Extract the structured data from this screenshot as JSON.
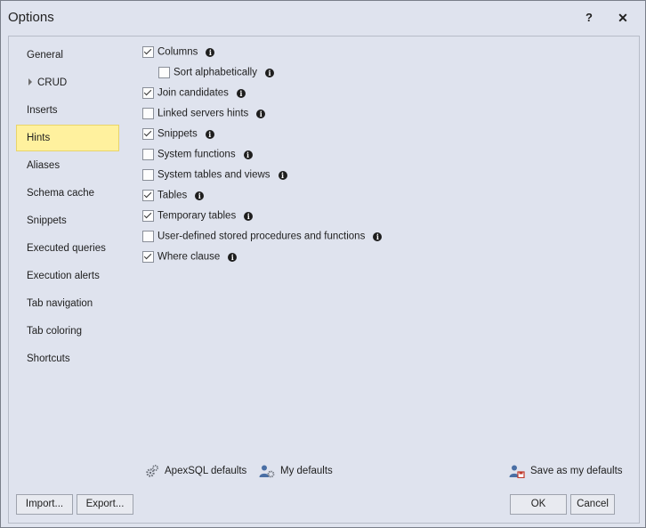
{
  "window": {
    "title": "Options",
    "help_label": "?",
    "close_label": "✕"
  },
  "nav": {
    "items": [
      {
        "label": "General",
        "expandable": false,
        "selected": false
      },
      {
        "label": "CRUD",
        "expandable": true,
        "selected": false
      },
      {
        "label": "Inserts",
        "expandable": false,
        "selected": false
      },
      {
        "label": "Hints",
        "expandable": false,
        "selected": true
      },
      {
        "label": "Aliases",
        "expandable": false,
        "selected": false
      },
      {
        "label": "Schema cache",
        "expandable": false,
        "selected": false
      },
      {
        "label": "Snippets",
        "expandable": false,
        "selected": false
      },
      {
        "label": "Executed queries",
        "expandable": false,
        "selected": false
      },
      {
        "label": "Execution alerts",
        "expandable": false,
        "selected": false
      },
      {
        "label": "Tab navigation",
        "expandable": false,
        "selected": false
      },
      {
        "label": "Tab coloring",
        "expandable": false,
        "selected": false
      },
      {
        "label": "Shortcuts",
        "expandable": false,
        "selected": false
      }
    ]
  },
  "options": [
    {
      "label": "Columns",
      "checked": true,
      "indent": false
    },
    {
      "label": "Sort alphabetically",
      "checked": false,
      "indent": true
    },
    {
      "label": "Join candidates",
      "checked": true,
      "indent": false
    },
    {
      "label": "Linked servers hints",
      "checked": false,
      "indent": false
    },
    {
      "label": "Snippets",
      "checked": true,
      "indent": false
    },
    {
      "label": "System functions",
      "checked": false,
      "indent": false
    },
    {
      "label": "System tables and views",
      "checked": false,
      "indent": false
    },
    {
      "label": "Tables",
      "checked": true,
      "indent": false
    },
    {
      "label": "Temporary tables",
      "checked": true,
      "indent": false
    },
    {
      "label": "User-defined stored procedures and functions",
      "checked": false,
      "indent": false
    },
    {
      "label": "Where clause",
      "checked": true,
      "indent": false
    }
  ],
  "defaults": {
    "apexsql_label": "ApexSQL defaults",
    "my_label": "My defaults",
    "save_label": "Save as my defaults"
  },
  "buttons": {
    "import": "Import...",
    "export": "Export...",
    "ok": "OK",
    "cancel": "Cancel"
  },
  "colors": {
    "selected_bg": "#fff19e",
    "window_bg": "#dfe3ee",
    "icon_blue": "#4a6fa5",
    "icon_red": "#c0392b"
  }
}
